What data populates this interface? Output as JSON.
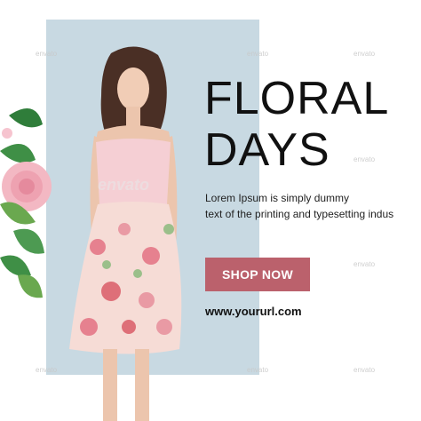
{
  "headline": {
    "line1": "FLORAL",
    "line2": "DAYS"
  },
  "description": {
    "line1": "Lorem Ipsum is simply dummy",
    "line2": "text of the printing and typesetting indus"
  },
  "cta": {
    "label": "SHOP NOW"
  },
  "website": {
    "url": "www.yoururl.com"
  },
  "watermark": {
    "small": "envato",
    "large": "envato"
  },
  "colors": {
    "panel": "#c8d9e2",
    "button": "#bb616c",
    "text": "#111111",
    "background": "#ffffff"
  }
}
